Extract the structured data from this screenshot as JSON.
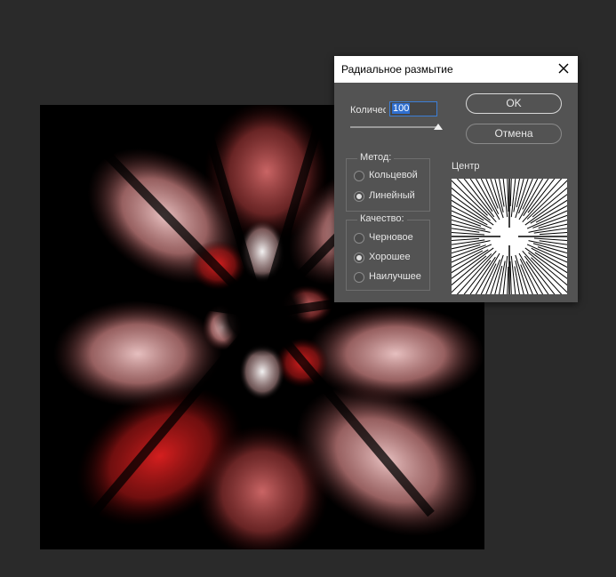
{
  "dialog": {
    "title": "Радиальное размытие",
    "close_icon": "close-icon",
    "amount_label": "Количество",
    "amount_value": "100",
    "amount_slider_fraction": 1.0,
    "ok_label": "OK",
    "cancel_label": "Отмена",
    "method": {
      "legend": "Метод:",
      "options": [
        {
          "label": "Кольцевой",
          "selected": false
        },
        {
          "label": "Линейный",
          "selected": true
        }
      ]
    },
    "quality": {
      "legend": "Качество:",
      "options": [
        {
          "label": "Черновое",
          "selected": false
        },
        {
          "label": "Хорошее",
          "selected": true
        },
        {
          "label": "Наилучшее",
          "selected": false
        }
      ]
    },
    "center_label": "Центр"
  },
  "colors": {
    "workspace_bg": "#2a2a2a",
    "dialog_bg": "#535353",
    "accent": "#3c7ed6",
    "canvas_red": "#cc1f1f",
    "canvas_pink": "#e8b0b0"
  }
}
